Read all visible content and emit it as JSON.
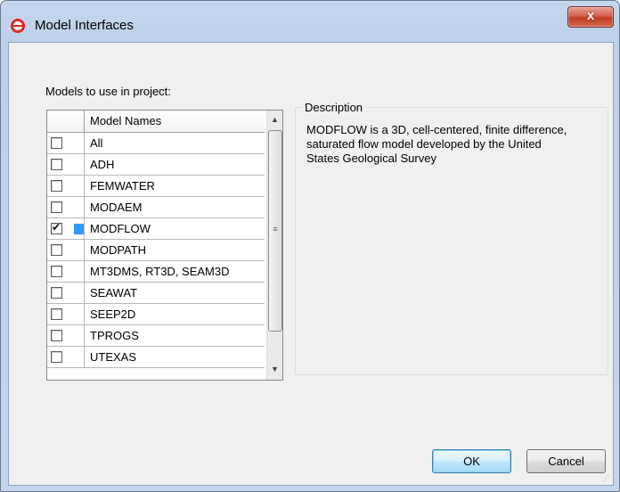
{
  "window": {
    "title": "Model Interfaces",
    "close_symbol": "x"
  },
  "models_label": "Models to use in project:",
  "grid": {
    "header": "Model Names",
    "rows": [
      {
        "name": "All",
        "checked": false
      },
      {
        "name": "ADH",
        "checked": false
      },
      {
        "name": "FEMWATER",
        "checked": false
      },
      {
        "name": "MODAEM",
        "checked": false
      },
      {
        "name": "MODFLOW",
        "checked": true
      },
      {
        "name": "MODPATH",
        "checked": false
      },
      {
        "name": "MT3DMS, RT3D, SEAM3D",
        "checked": false
      },
      {
        "name": "SEAWAT",
        "checked": false
      },
      {
        "name": "SEEP2D",
        "checked": false
      },
      {
        "name": "TPROGS",
        "checked": false
      },
      {
        "name": "UTEXAS",
        "checked": false
      }
    ]
  },
  "description": {
    "legend": "Description",
    "text": "MODFLOW is a 3D, cell-centered, finite difference, saturated flow model developed by the United States Geological Survey"
  },
  "buttons": {
    "ok": "OK",
    "cancel": "Cancel"
  },
  "icons": {
    "app": "app-logo-icon",
    "close": "close-icon",
    "scroll_up": "scroll-up-arrow-icon",
    "scroll_down": "scroll-down-arrow-icon"
  },
  "colors": {
    "titlebar": "#c4d7ee",
    "close_button": "#c13c22",
    "selection": "#3399ff",
    "default_button_border": "#3c7fb1"
  }
}
